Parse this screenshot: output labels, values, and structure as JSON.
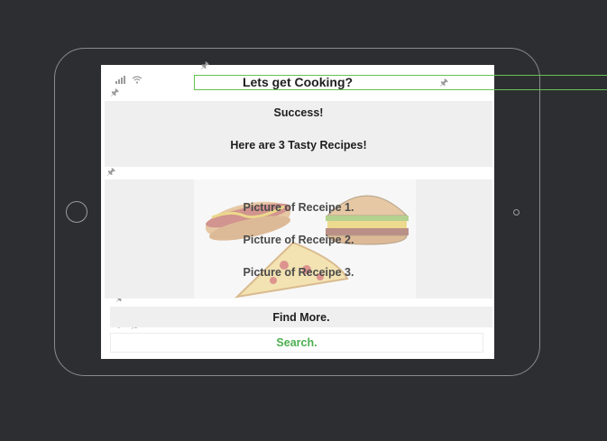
{
  "app": {
    "title": "Lets get Cooking?"
  },
  "status_bar": {
    "signal_icon": "cellular-signal-icon",
    "wifi_icon": "wifi-icon"
  },
  "result_panel": {
    "headline": "Success!",
    "subtitle": "Here are 3 Tasty Recipes!"
  },
  "recipes": {
    "items": [
      "Picture of Receipe 1.",
      "Picture of Receipe 2.",
      "Picture of Receipe 3."
    ],
    "background_art": [
      "hot-dog",
      "hamburger",
      "pizza-slice"
    ]
  },
  "actions": {
    "find_more": "Find More.",
    "search": "Search."
  },
  "colors": {
    "background": "#2d2e32",
    "accent_green": "#4caf50",
    "selection_outline": "#66c24f",
    "panel_gray": "#efefef"
  }
}
